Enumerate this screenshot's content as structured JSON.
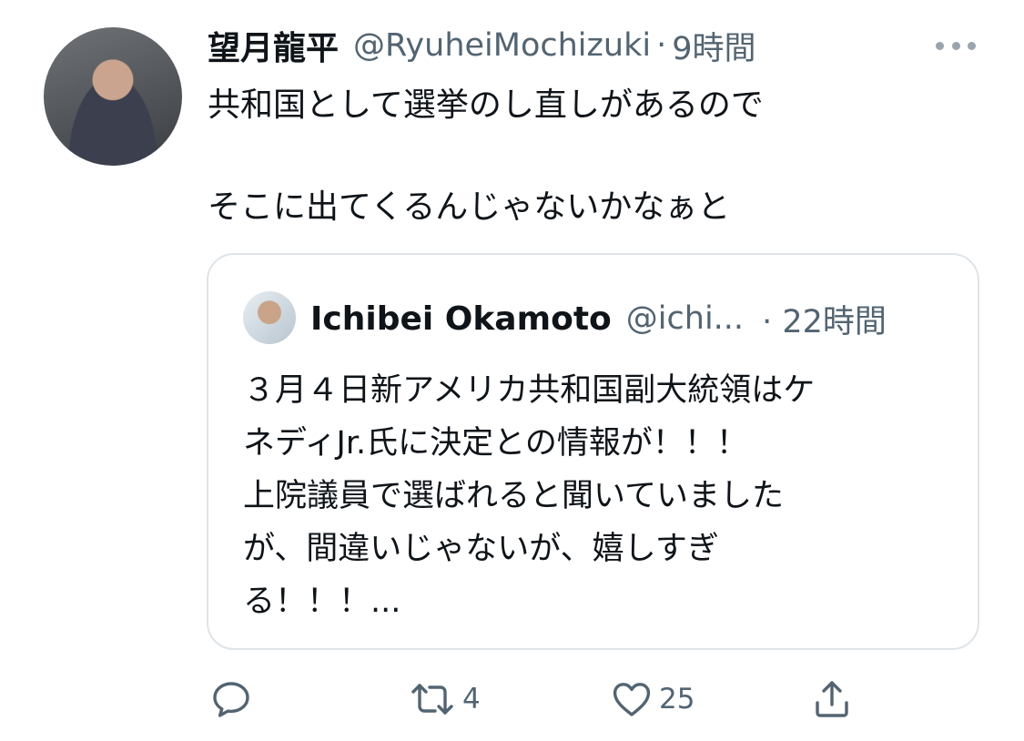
{
  "tweet": {
    "author_name": "望月龍平",
    "handle": "@RyuheiMochizuki",
    "separator": "·",
    "time": "9時間",
    "text_lines": [
      "共和国として選挙のし直しがあるので",
      "そこに出てくるんじゃないかなぁと"
    ]
  },
  "quote": {
    "author_name": "Ichibei Okamoto",
    "handle": "@ichi...",
    "time": "· 22時間",
    "text_lines": [
      "３月４日新アメリカ共和国副大統領はケ",
      "ネディJr.氏に決定との情報が！！！",
      "上院議員で選ばれると聞いていました",
      "が、間違いじゃないが、嬉しすぎ",
      "る！！！..."
    ]
  },
  "actions": {
    "reply_icon": "reply-icon",
    "retweet_icon": "retweet-icon",
    "retweet_count": "4",
    "like_icon": "heart-icon",
    "like_count": "25",
    "share_icon": "share-icon"
  },
  "colors": {
    "text": "#0f1419",
    "secondary": "#536471",
    "border": "#dfe4e8"
  }
}
